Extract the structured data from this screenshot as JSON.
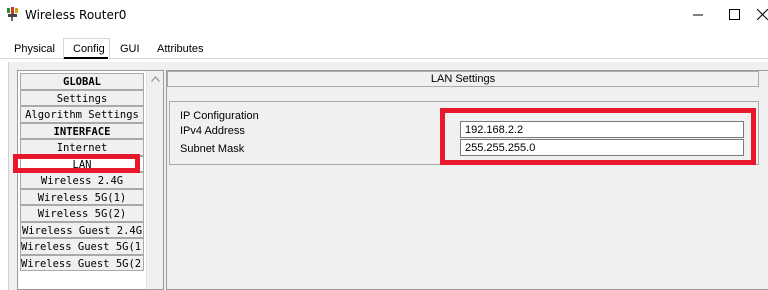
{
  "window": {
    "title": "Wireless Router0",
    "icon": "router-app-icon",
    "controls": {
      "minimize": "minimize-icon",
      "maximize": "maximize-icon",
      "close": "close-icon"
    }
  },
  "tabs": [
    {
      "label": "Physical"
    },
    {
      "label": "Config",
      "active": true
    },
    {
      "label": "GUI"
    },
    {
      "label": "Attributes"
    }
  ],
  "sidebar": {
    "items": [
      {
        "label": "GLOBAL",
        "header": true
      },
      {
        "label": "Settings"
      },
      {
        "label": "Algorithm Settings"
      },
      {
        "label": "INTERFACE",
        "header": true
      },
      {
        "label": "Internet"
      },
      {
        "label": "LAN",
        "selected": true
      },
      {
        "label": "Wireless 2.4G"
      },
      {
        "label": "Wireless 5G(1)"
      },
      {
        "label": "Wireless 5G(2)"
      },
      {
        "label": "Wireless Guest 2.4G"
      },
      {
        "label": "Wireless Guest 5G(1)"
      },
      {
        "label": "Wireless Guest 5G(2)"
      }
    ]
  },
  "panel": {
    "title": "LAN Settings",
    "section": "IP Configuration",
    "ipv4": {
      "label": "IPv4 Address",
      "value": "192.168.2.2"
    },
    "subnet": {
      "label": "Subnet Mask",
      "value": "255.255.255.0"
    }
  },
  "colors": {
    "highlight": "#e8182c",
    "panel_bg": "#f0f0f0"
  }
}
